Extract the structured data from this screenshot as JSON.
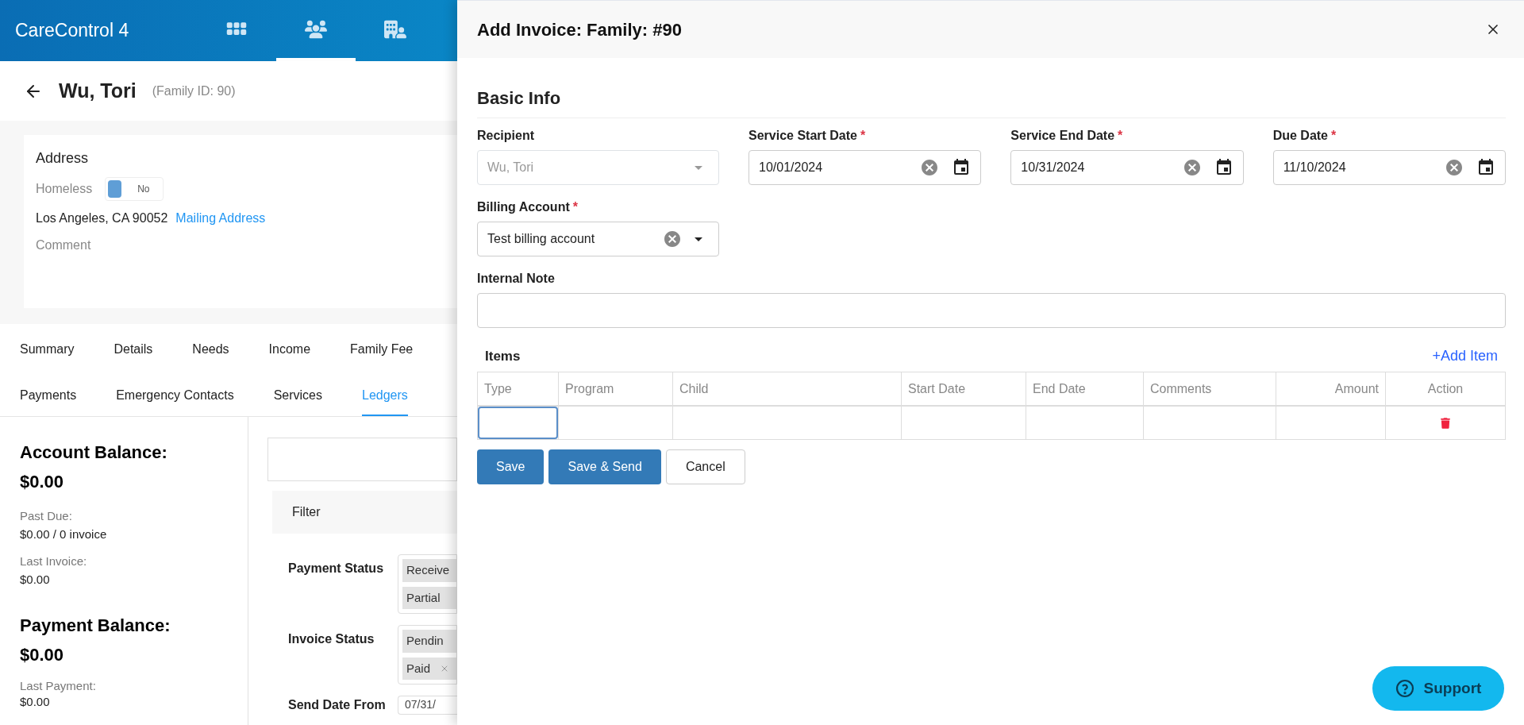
{
  "app": {
    "title": "CareControl 4",
    "nav": [
      {
        "selected": false
      },
      {
        "selected": true
      },
      {
        "selected": false
      }
    ]
  },
  "family": {
    "name": "Wu, Tori",
    "id_label": "(Family ID: 90)"
  },
  "address": {
    "title": "Address",
    "homeless_label": "Homeless",
    "homeless_toggle": {
      "label": "No",
      "on": false
    },
    "city": "Los Angeles, CA 90052",
    "mailing_link": "Mailing Address",
    "comment_label": "Comment"
  },
  "tabs": [
    {
      "label": "Summary",
      "selected": false
    },
    {
      "label": "Details",
      "selected": false
    },
    {
      "label": "Needs",
      "selected": false
    },
    {
      "label": "Income",
      "selected": false
    },
    {
      "label": "Family Fee",
      "selected": false
    },
    {
      "label": "Payments",
      "selected": false
    },
    {
      "label": "Emergency Contacts",
      "selected": false
    },
    {
      "label": "Services",
      "selected": false
    },
    {
      "label": "Ledgers",
      "selected": true
    }
  ],
  "balances": {
    "account_title": "Account Balance:",
    "account_value": "$0.00",
    "past_due_label": "Past Due:",
    "past_due_value": "$0.00 / 0 invoice",
    "last_invoice_label": "Last Invoice:",
    "last_invoice_value": "$0.00",
    "payment_title": "Payment Balance:",
    "payment_value": "$0.00",
    "last_payment_label": "Last Payment:",
    "last_payment_value": "$0.00"
  },
  "filter": {
    "title": "Filter",
    "groups": [
      {
        "label": "Payment Status",
        "chips": [
          "Receive",
          "Partial"
        ]
      },
      {
        "label": "Invoice Status",
        "chips": [
          "Pendin",
          "Paid"
        ]
      }
    ],
    "send_date_label": "Send Date From",
    "send_date_value": "07/31/"
  },
  "dialog": {
    "title": "Add Invoice: Family: #90",
    "section": "Basic Info",
    "fields": [
      {
        "kind": "select",
        "label": "Recipient",
        "value": "Wu, Tori",
        "disabled": true
      },
      {
        "kind": "date",
        "label": "Service Start Date",
        "required_mark": "*",
        "value": "10/01/2024"
      },
      {
        "kind": "date",
        "label": "Service End Date",
        "required_mark": "*",
        "value": "10/31/2024"
      },
      {
        "kind": "date",
        "label": "Due Date",
        "required_mark": "*",
        "value": "11/10/2024"
      }
    ],
    "billing": {
      "label": "Billing Account",
      "required_mark": "*",
      "value": "Test billing account"
    },
    "note": {
      "label": "Internal Note"
    },
    "items": {
      "title": "Items",
      "add_label": "+Add Item",
      "columns": [
        "Type",
        "Program",
        "Child",
        "Start Date",
        "End Date",
        "Comments",
        "Amount",
        "Action"
      ]
    },
    "buttons": [
      {
        "label": "Save",
        "kind": "primary"
      },
      {
        "label": "Save & Send",
        "kind": "primary"
      },
      {
        "label": "Cancel",
        "kind": "secondary"
      }
    ]
  },
  "support": {
    "label": "Support"
  }
}
